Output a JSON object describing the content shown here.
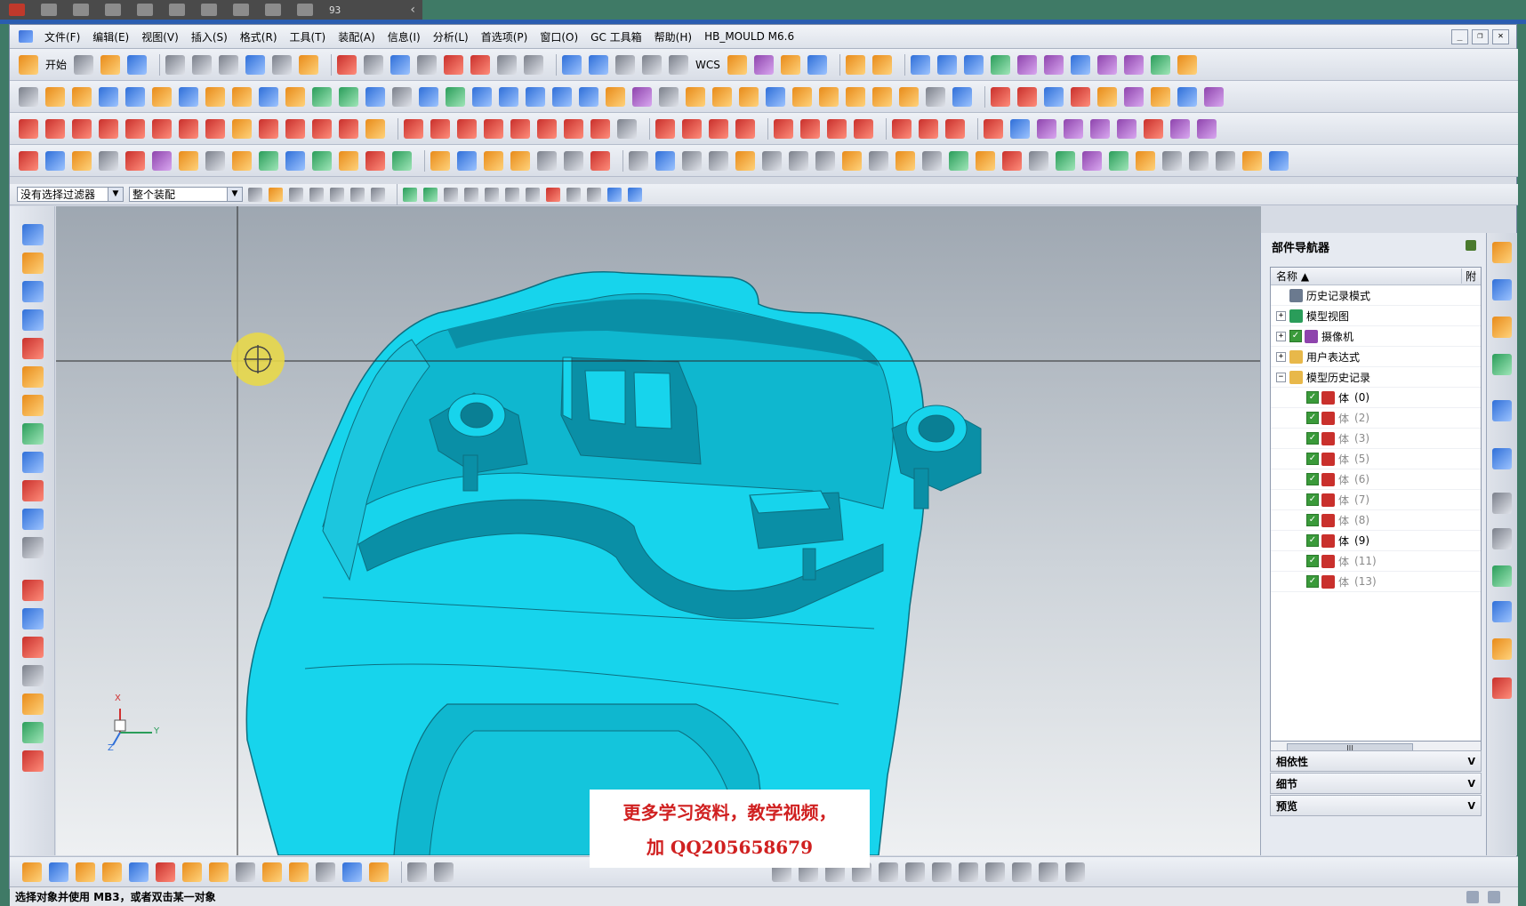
{
  "recording_bar": {
    "count": "93"
  },
  "menubar": {
    "items": [
      "文件(F)",
      "编辑(E)",
      "视图(V)",
      "插入(S)",
      "格式(R)",
      "工具(T)",
      "装配(A)",
      "信息(I)",
      "分析(L)",
      "首选项(P)",
      "窗口(O)",
      "GC 工具箱",
      "帮助(H)",
      "HB_MOULD M6.6"
    ],
    "window_buttons": [
      "_",
      "❐",
      "✕"
    ]
  },
  "toolbar1": {
    "start_label": "开始",
    "wcs_label": "WCS"
  },
  "filter": {
    "type_filter": "没有选择过滤器",
    "scope": "整个装配"
  },
  "overlay": {
    "line1": "更多学习资料，教学视频，",
    "line2": "加 QQ205658679"
  },
  "navigator": {
    "title": "部件导航器",
    "columns": [
      "名称",
      "附"
    ],
    "tree": [
      {
        "label": "历史记录模式",
        "level": 0,
        "expander": "",
        "icon": "clock-icon",
        "checked": false
      },
      {
        "label": "模型视图",
        "level": 0,
        "expander": "+",
        "icon": "model-view-icon",
        "checked": false
      },
      {
        "label": "摄像机",
        "level": 0,
        "expander": "+",
        "icon": "camera-icon",
        "checked": true
      },
      {
        "label": "用户表达式",
        "level": 0,
        "expander": "+",
        "icon": "folder-icon",
        "checked": false
      },
      {
        "label": "模型历史记录",
        "level": 0,
        "expander": "−",
        "icon": "folder-icon",
        "checked": false
      },
      {
        "label": "体",
        "suffix": "(0)",
        "level": 1,
        "icon": "body-icon",
        "checked": true,
        "dim": false
      },
      {
        "label": "体",
        "suffix": "(2)",
        "level": 1,
        "icon": "body-icon",
        "checked": true,
        "dim": true
      },
      {
        "label": "体",
        "suffix": "(3)",
        "level": 1,
        "icon": "body-icon",
        "checked": true,
        "dim": true
      },
      {
        "label": "体",
        "suffix": "(5)",
        "level": 1,
        "icon": "body-icon",
        "checked": true,
        "dim": true
      },
      {
        "label": "体",
        "suffix": "(6)",
        "level": 1,
        "icon": "body-icon",
        "checked": true,
        "dim": true
      },
      {
        "label": "体",
        "suffix": "(7)",
        "level": 1,
        "icon": "body-icon",
        "checked": true,
        "dim": true
      },
      {
        "label": "体",
        "suffix": "(8)",
        "level": 1,
        "icon": "body-icon",
        "checked": true,
        "dim": true
      },
      {
        "label": "体",
        "suffix": "(9)",
        "level": 1,
        "icon": "body-icon",
        "checked": true,
        "dim": false
      },
      {
        "label": "体",
        "suffix": "(11)",
        "level": 1,
        "icon": "body-icon",
        "checked": true,
        "dim": true
      },
      {
        "label": "体",
        "suffix": "(13)",
        "level": 1,
        "icon": "body-icon",
        "checked": true,
        "dim": true
      }
    ],
    "panels": [
      "相依性",
      "细节",
      "预览"
    ]
  },
  "triad": {
    "x_label": "X",
    "y_label": "Y",
    "z_label": "Z"
  },
  "statusbar": {
    "message": "选择对象并使用 MB3，或者双击某一对象"
  },
  "colors": {
    "part": "#17d4ec",
    "part_shadow": "#0a8fa6",
    "accent": "#2a5db0"
  }
}
